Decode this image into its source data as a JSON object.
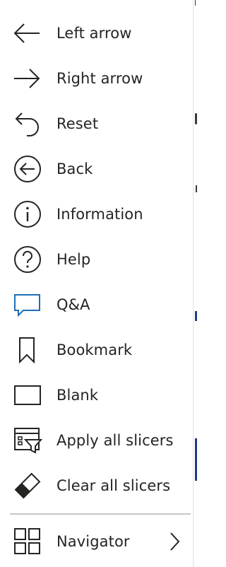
{
  "menu": {
    "items": [
      {
        "label": "Left arrow",
        "icon": "left-arrow-icon"
      },
      {
        "label": "Right arrow",
        "icon": "right-arrow-icon"
      },
      {
        "label": "Reset",
        "icon": "reset-icon"
      },
      {
        "label": "Back",
        "icon": "back-circle-icon"
      },
      {
        "label": "Information",
        "icon": "information-icon"
      },
      {
        "label": "Help",
        "icon": "help-icon"
      },
      {
        "label": "Q&A",
        "icon": "qna-icon"
      },
      {
        "label": "Bookmark",
        "icon": "bookmark-icon"
      },
      {
        "label": "Blank",
        "icon": "blank-icon"
      },
      {
        "label": "Apply all slicers",
        "icon": "apply-slicers-icon"
      },
      {
        "label": "Clear all slicers",
        "icon": "clear-slicers-icon"
      }
    ],
    "navigator": {
      "label": "Navigator",
      "icon": "navigator-grid-icon",
      "submenu_icon": "chevron-right-icon"
    }
  },
  "colors": {
    "text": "#252423",
    "icon_stroke": "#252423",
    "qna_accent": "#1f6fb5",
    "divider": "#c8c6c4"
  }
}
